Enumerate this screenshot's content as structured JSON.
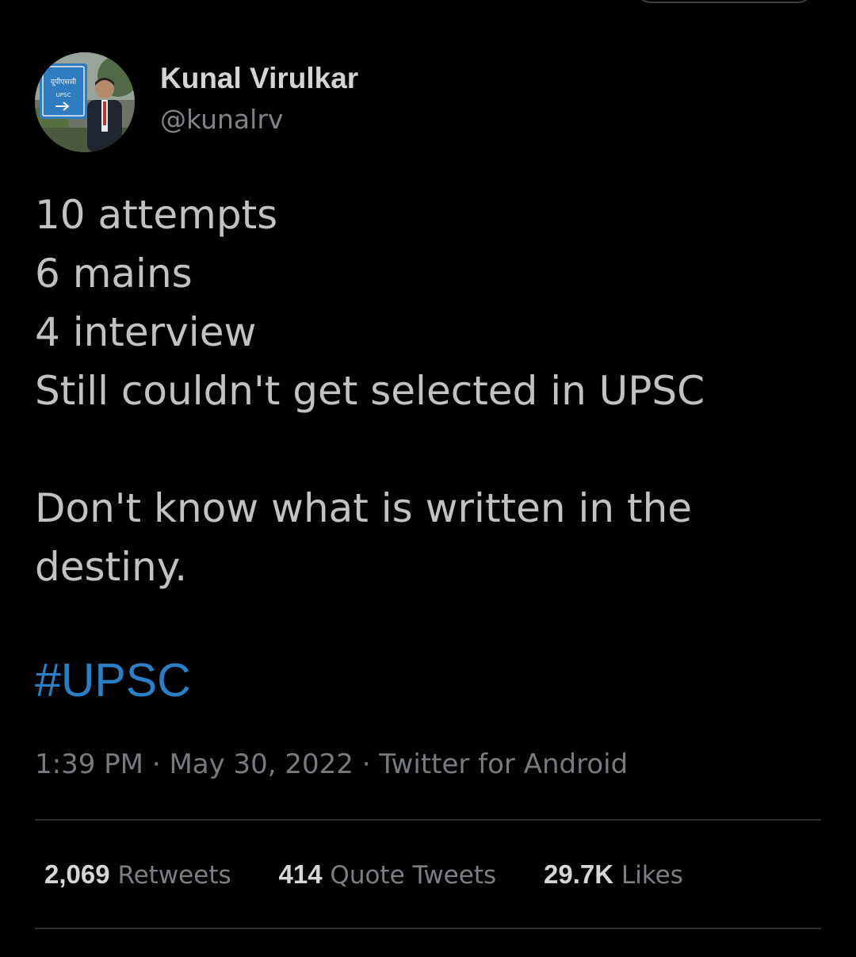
{
  "tweet": {
    "author": {
      "name": "Kunal Virulkar",
      "handle": "@kunalrv",
      "avatar_sign": {
        "line1": "यूपीएससी",
        "line2": "UPSC"
      }
    },
    "lines": [
      "10 attempts",
      "6 mains",
      "4 interview",
      "Still couldn't get selected in UPSC",
      "",
      "Don't know what is written in the",
      "destiny."
    ],
    "hashtag": "#UPSC",
    "meta": {
      "time": "1:39 PM",
      "separator": "·",
      "date": "May 30, 2022",
      "source": "Twitter for Android"
    },
    "stats": {
      "retweets": {
        "count": "2,069",
        "label": "Retweets"
      },
      "quotes": {
        "count": "414",
        "label": "Quote Tweets"
      },
      "likes": {
        "count": "29.7K",
        "label": "Likes"
      }
    }
  },
  "colors": {
    "background": "#000000",
    "text": "#c2c2c2",
    "secondary_text": "#777b80",
    "link": "#2b7fc4",
    "divider": "#2a2e32"
  }
}
